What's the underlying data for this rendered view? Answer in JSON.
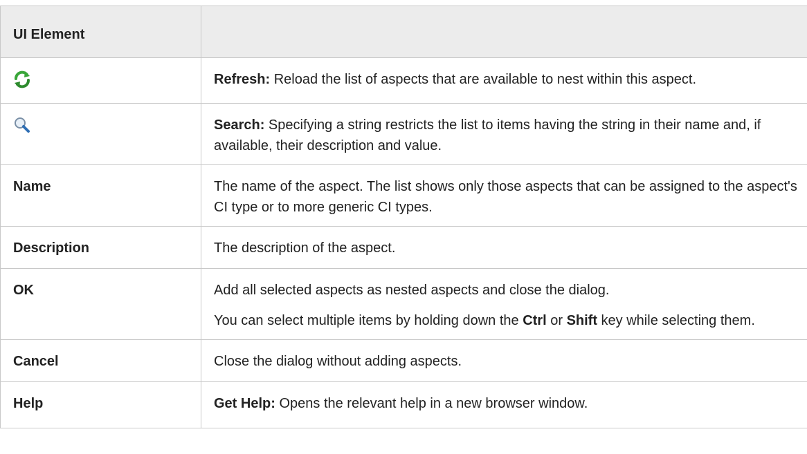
{
  "table": {
    "header": {
      "col1": "UI Element",
      "col2": ""
    },
    "rows": [
      {
        "element_icon": "refresh-icon",
        "description": {
          "label": "Refresh:",
          "text": " Reload the list of aspects that are available to nest within this aspect."
        }
      },
      {
        "element_icon": "search-icon",
        "description": {
          "label": "Search:",
          "text": " Specifying a string restricts the list to items having the string in their name and, if available, their description and value."
        }
      },
      {
        "element": "Name",
        "description": {
          "text": "The name of the aspect. The list shows only those aspects that can be assigned to the aspect's CI type or to more generic CI types."
        }
      },
      {
        "element": "Description",
        "description": {
          "text": "The description of the aspect."
        }
      },
      {
        "element": "OK",
        "description": {
          "text": "Add all selected aspects as nested aspects and close the dialog.",
          "text2_a": "You can select multiple items by holding down the ",
          "key1": "Ctrl",
          "text2_b": " or ",
          "key2": "Shift",
          "text2_c": " key while selecting them."
        }
      },
      {
        "element": "Cancel",
        "description": {
          "text": "Close the dialog without adding aspects."
        }
      },
      {
        "element": "Help",
        "description": {
          "label": "Get Help:",
          "text": " Opens the relevant help in a new browser window."
        }
      }
    ]
  },
  "colors": {
    "header_bg": "#ececec",
    "border": "#c8c8c8",
    "refresh_green": "#3aa63a",
    "search_blue": "#2f6fb5"
  }
}
